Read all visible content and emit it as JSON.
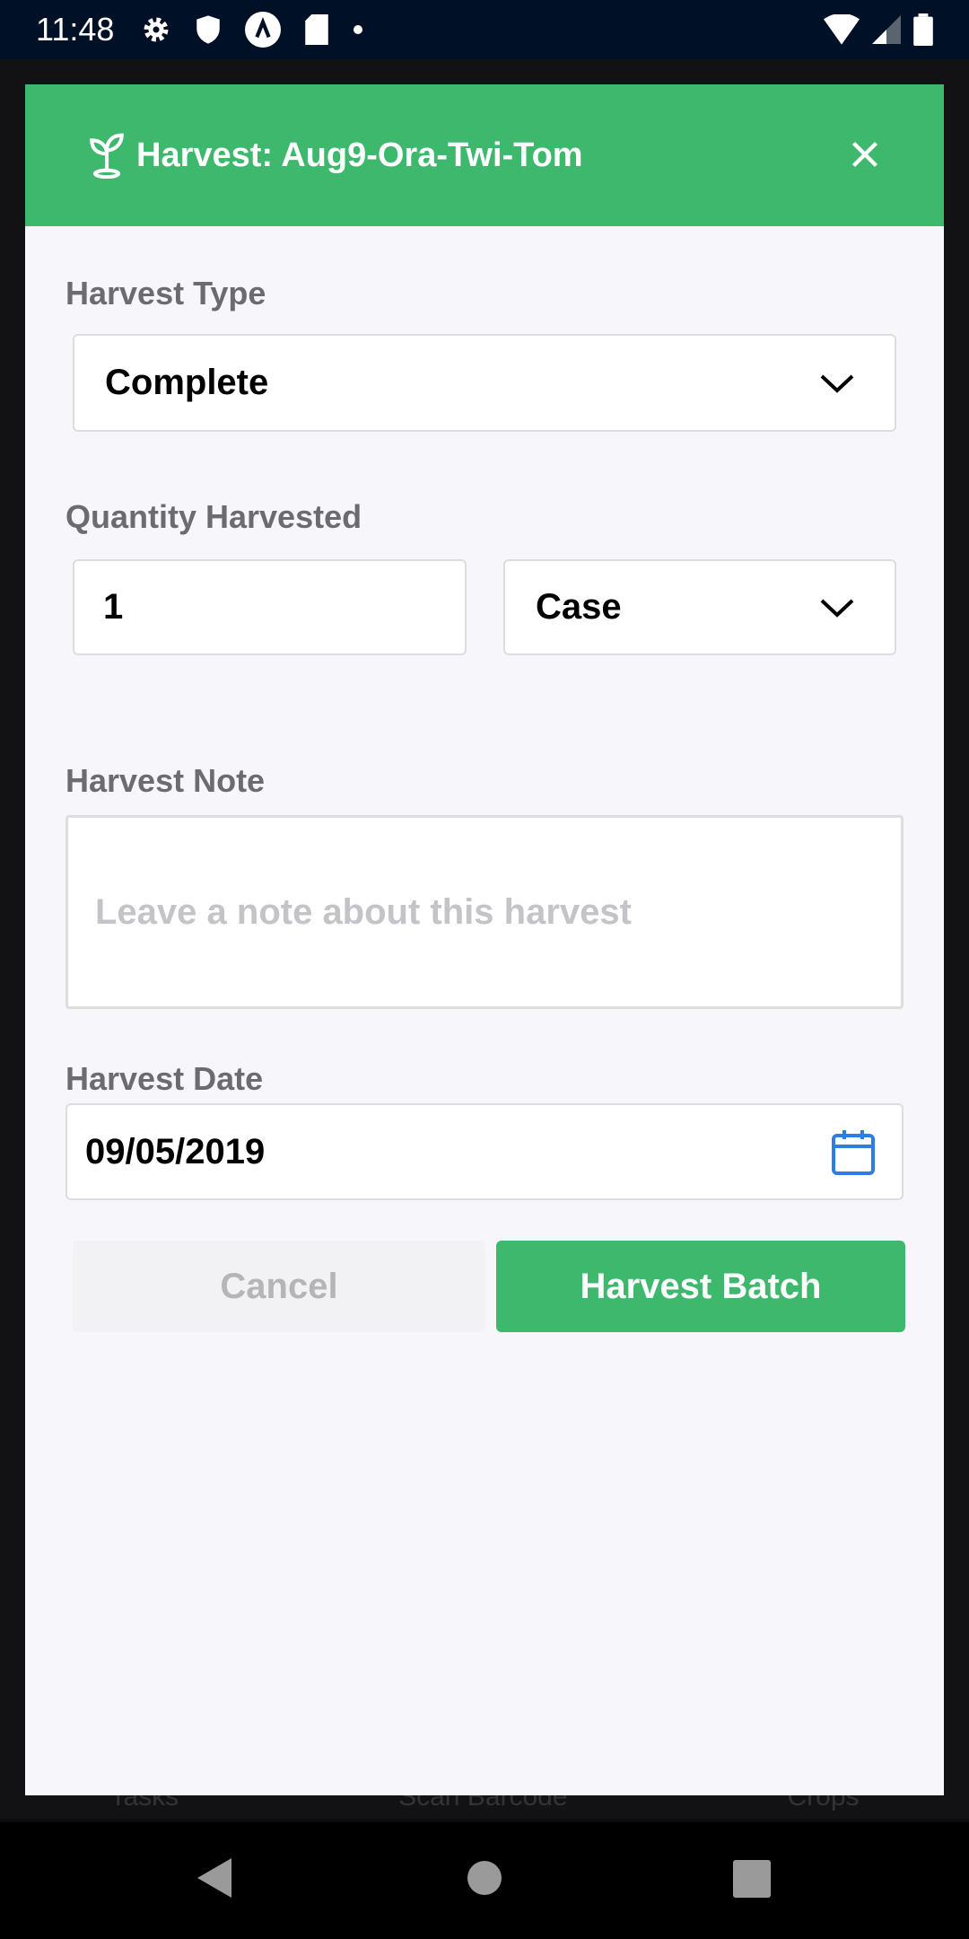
{
  "status_bar": {
    "time": "11:48",
    "icons": [
      "gear-icon",
      "shield-icon",
      "app-icon",
      "sd-card-icon",
      "dot-icon",
      "wifi-icon",
      "signal-icon",
      "battery-icon"
    ]
  },
  "background_tabs": [
    "Tasks",
    "Scan Barcode",
    "Crops"
  ],
  "modal": {
    "header": {
      "icon": "sprout-icon",
      "title": "Harvest:  Aug9-Ora-Twi-Tom",
      "close_icon": "close-icon",
      "color": "#3db86d"
    },
    "harvest_type": {
      "label": "Harvest Type",
      "value": "Complete"
    },
    "quantity": {
      "label": "Quantity Harvested",
      "value": "1",
      "unit": "Case"
    },
    "note": {
      "label": "Harvest Note",
      "placeholder": "Leave a note about this harvest"
    },
    "date": {
      "label": "Harvest Date",
      "value": "09/05/2019",
      "icon": "calendar-icon"
    },
    "buttons": {
      "cancel": "Cancel",
      "submit": "Harvest Batch"
    }
  }
}
